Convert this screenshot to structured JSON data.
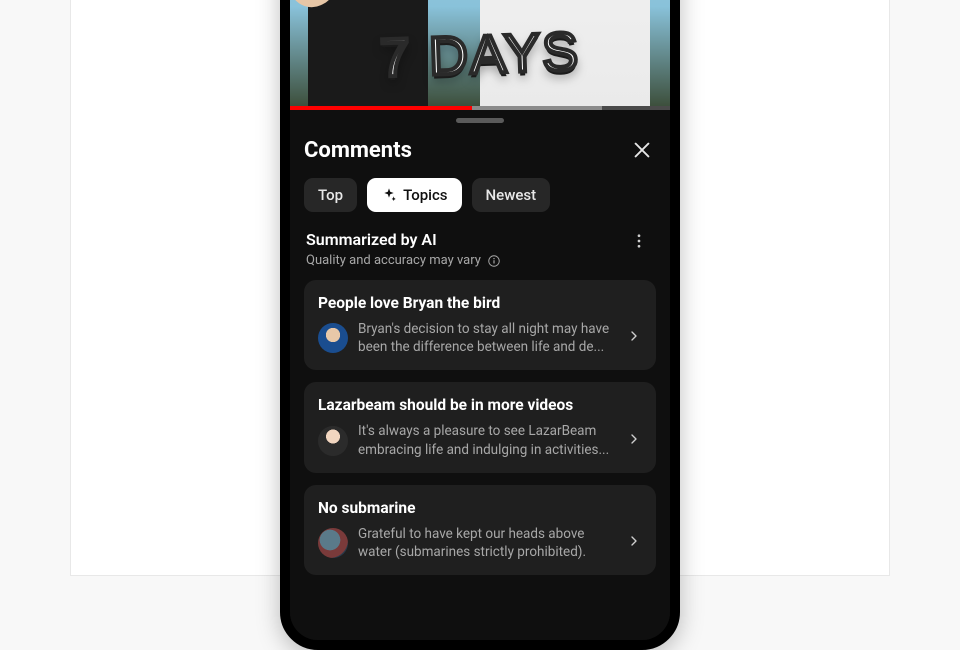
{
  "video": {
    "overlay_text": "7 DAYS"
  },
  "sheet": {
    "title": "Comments",
    "tabs": {
      "top": "Top",
      "topics": "Topics",
      "newest": "Newest"
    },
    "summary": {
      "label": "Summarized by AI",
      "disclaimer": "Quality and accuracy may vary"
    },
    "topics": [
      {
        "title": "People love Bryan the bird",
        "snippet": "Bryan's decision to stay all night may have been the difference between life and de..."
      },
      {
        "title": "Lazarbeam should be in more videos",
        "snippet": "It's always a pleasure to see LazarBeam embracing life and indulging in activities..."
      },
      {
        "title": "No submarine",
        "snippet": "Grateful to have kept our heads above water (submarines strictly prohibited)."
      }
    ]
  }
}
